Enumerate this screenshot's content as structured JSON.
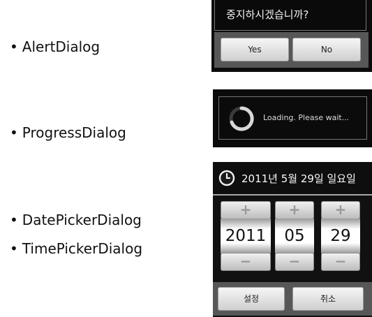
{
  "labels": {
    "alert": "AlertDialog",
    "progress": "ProgressDialog",
    "datepicker": "DatePickerDialog",
    "timepicker": "TimePickerDialog",
    "bullet": "•"
  },
  "alert_dialog": {
    "message": "중지하시겠습니까?",
    "positive": "Yes",
    "negative": "No"
  },
  "progress_dialog": {
    "message": "Loading. Please wait...",
    "icon": "spinner-icon"
  },
  "date_picker_dialog": {
    "title": "2011년 5월 29일 일요일",
    "icon": "clock-icon",
    "plus": "+",
    "minus": "−",
    "year": "2011",
    "month": "05",
    "day": "29",
    "confirm": "설정",
    "cancel": "취소"
  }
}
